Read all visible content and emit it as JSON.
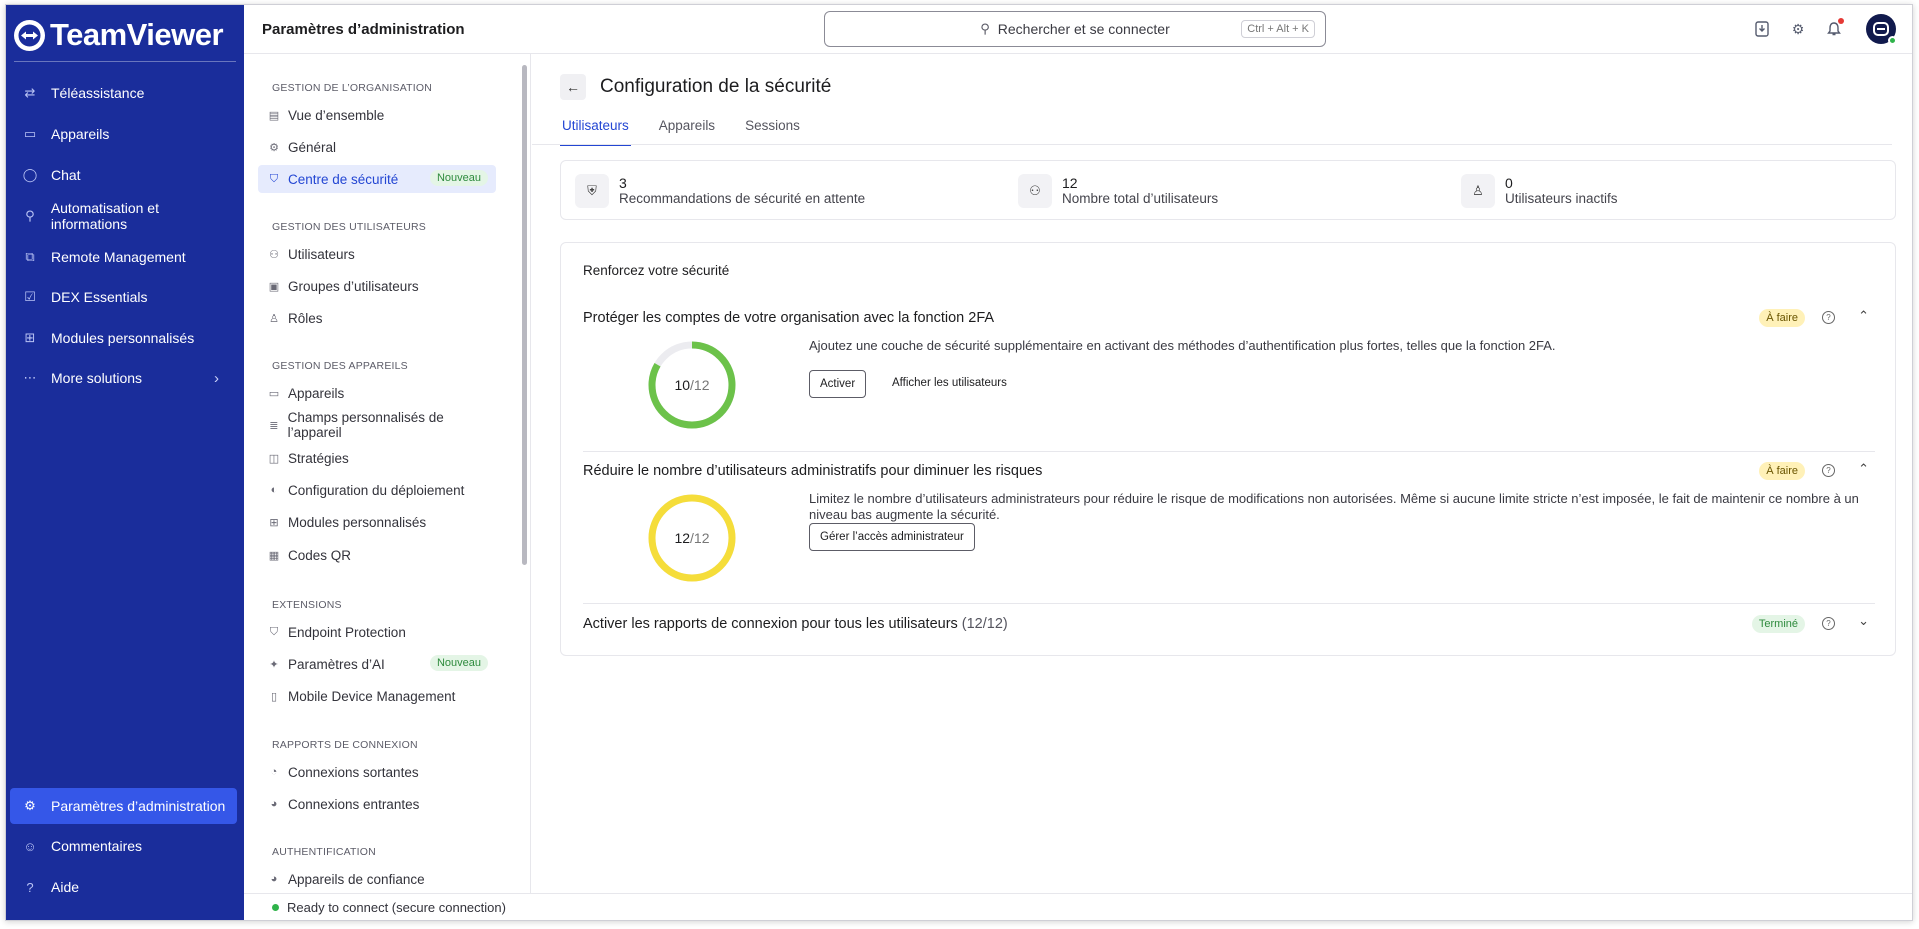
{
  "app": {
    "brand": "TeamViewer"
  },
  "nav": {
    "items": [
      {
        "label": "Téléassistance",
        "icon": "arrows-swap-icon"
      },
      {
        "label": "Appareils",
        "icon": "devices-icon"
      },
      {
        "label": "Chat",
        "icon": "chat-icon"
      },
      {
        "label": "Automatisation et informations",
        "icon": "automation-icon"
      },
      {
        "label": "Remote Management",
        "icon": "remote-management-icon"
      },
      {
        "label": "DEX Essentials",
        "icon": "dex-icon"
      },
      {
        "label": "Modules personnalisés",
        "icon": "modules-icon"
      },
      {
        "label": "More solutions",
        "icon": "more-icon"
      }
    ],
    "bottom": [
      {
        "label": "Paramètres d’administration",
        "icon": "admin-settings-icon"
      },
      {
        "label": "Commentaires",
        "icon": "feedback-icon"
      },
      {
        "label": "Aide",
        "icon": "help-icon"
      }
    ]
  },
  "topbar": {
    "title": "Paramètres d’administration",
    "search_label": "Rechercher et se connecter",
    "search_shortcut": "Ctrl + Alt + K"
  },
  "subnav": {
    "sections": [
      {
        "heading": "GESTION DE L’ORGANISATION",
        "items": [
          {
            "label": "Vue d’ensemble"
          },
          {
            "label": "Général"
          },
          {
            "label": "Centre de sécurité",
            "badge": "Nouveau"
          }
        ]
      },
      {
        "heading": "GESTION DES UTILISATEURS",
        "items": [
          {
            "label": "Utilisateurs"
          },
          {
            "label": "Groupes d’utilisateurs"
          },
          {
            "label": "Rôles"
          }
        ]
      },
      {
        "heading": "GESTION DES APPAREILS",
        "items": [
          {
            "label": "Appareils"
          },
          {
            "label": "Champs personnalisés de l’appareil"
          },
          {
            "label": "Stratégies"
          },
          {
            "label": "Configuration du déploiement"
          },
          {
            "label": "Modules personnalisés"
          },
          {
            "label": "Codes QR"
          }
        ]
      },
      {
        "heading": "EXTENSIONS",
        "items": [
          {
            "label": "Endpoint Protection"
          },
          {
            "label": "Paramètres d’AI",
            "badge": "Nouveau"
          },
          {
            "label": "Mobile Device Management"
          }
        ]
      },
      {
        "heading": "RAPPORTS DE CONNEXION",
        "items": [
          {
            "label": "Connexions sortantes"
          },
          {
            "label": "Connexions entrantes"
          }
        ]
      },
      {
        "heading": "AUTHENTIFICATION",
        "items": [
          {
            "label": "Appareils de confiance"
          }
        ]
      }
    ]
  },
  "main": {
    "title": "Configuration de la sécurité",
    "tabs": [
      "Utilisateurs",
      "Appareils",
      "Sessions"
    ],
    "stats": [
      {
        "value": "3",
        "label": "Recommandations de sécurité en attente"
      },
      {
        "value": "12",
        "label": "Nombre total d’utilisateurs"
      },
      {
        "value": "0",
        "label": "Utilisateurs inactifs"
      }
    ],
    "card_title": "Renforcez votre sécurité",
    "sections": [
      {
        "title": "Protéger les comptes de votre organisation avec la fonction 2FA",
        "status": "À faire",
        "progress": {
          "done": "10",
          "total": "/12",
          "ratio": 0.8333,
          "color": "#6cc24a"
        },
        "description": "Ajoutez une couche de sécurité supplémentaire en activant des méthodes d’authentification plus fortes, telles que la fonction 2FA.",
        "primary_button": "Activer",
        "secondary_button": "Afficher les utilisateurs"
      },
      {
        "title": "Réduire le nombre d’utilisateurs administratifs pour diminuer les risques",
        "status": "À faire",
        "progress": {
          "done": "12",
          "total": "/12",
          "ratio": 1.0,
          "color": "#f5dd3a"
        },
        "description": "Limitez le nombre d’utilisateurs administrateurs pour réduire le risque de modifications non autorisées. Même si aucune limite stricte n’est imposée, le fait de maintenir ce nombre à un niveau bas augmente la sécurité.",
        "primary_button": "Gérer l’accès administrateur"
      },
      {
        "title": "Activer les rapports de connexion pour tous les utilisateurs",
        "count": "(12/12)",
        "status": "Terminé"
      }
    ]
  },
  "statusbar": {
    "text": "Ready to connect (secure connection)"
  }
}
